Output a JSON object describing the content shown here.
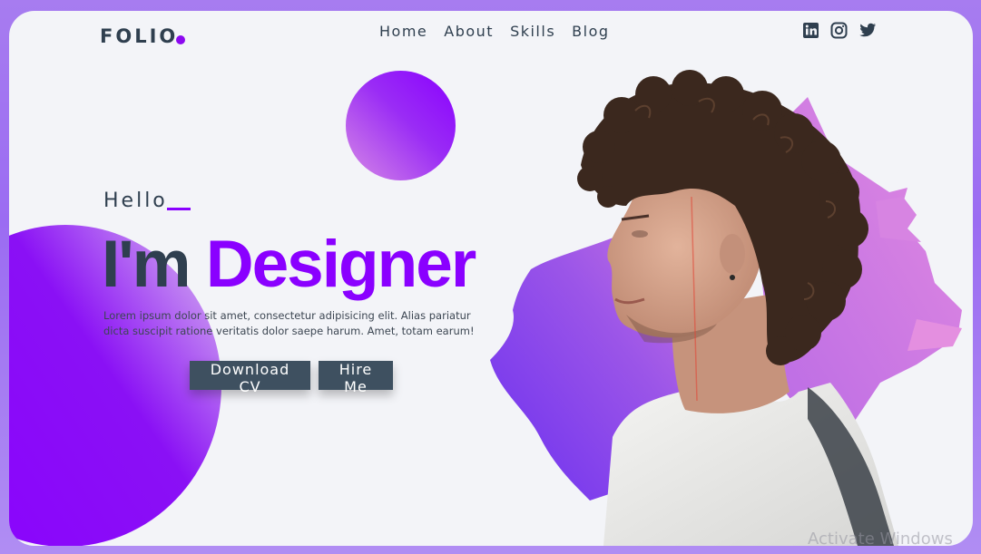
{
  "brand": {
    "name": "FOLIO"
  },
  "nav": {
    "items": [
      "Home",
      "About",
      "Skills",
      "Blog"
    ]
  },
  "social": {
    "icons": [
      "linkedin-icon",
      "instagram-icon",
      "twitter-icon"
    ]
  },
  "hero": {
    "greeting": "Hello",
    "headline_prefix": "I'm",
    "headline_accent": "Designer",
    "description_line1": "Lorem ipsum dolor sit amet, consectetur adipisicing elit. Alias pariatur",
    "description_line2": "dicta suscipit ratione veritatis dolor saepe harum. Amet, totam earum!",
    "download_label": "Download CV",
    "hire_label": "Hire Me"
  },
  "system": {
    "watermark": "Activate Windows"
  },
  "colors": {
    "accent": "#8a00ff",
    "dark": "#2f3f4f",
    "button": "#3e5060",
    "background": "#f3f4f8"
  }
}
